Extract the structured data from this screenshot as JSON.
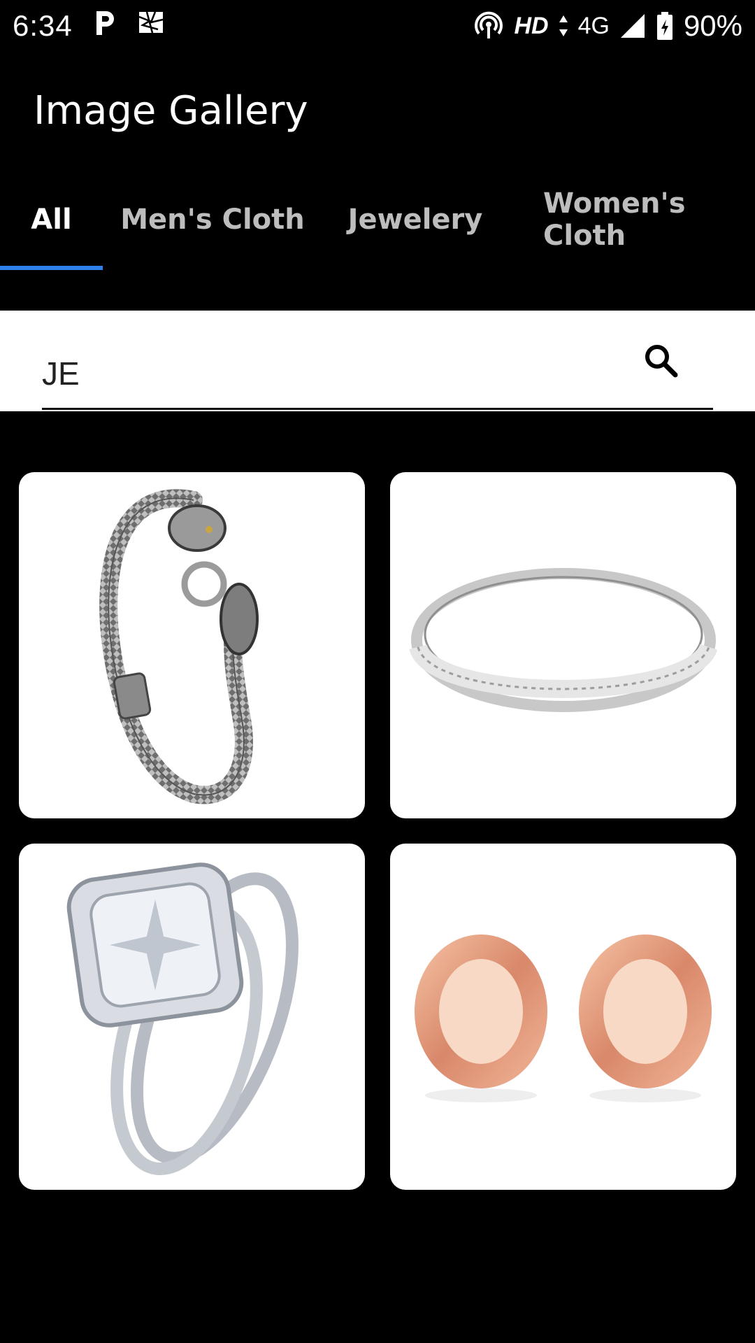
{
  "status_bar": {
    "time": "6:34",
    "network_hd": "HD",
    "network_type": "4G",
    "battery_percent": "90%",
    "icons": [
      "p-app-icon",
      "notification-icon",
      "hotspot-icon",
      "signal-icon",
      "battery-icon"
    ]
  },
  "app_bar": {
    "title": "Image Gallery"
  },
  "tabs": [
    {
      "label": "All",
      "selected": true
    },
    {
      "label": "Men's Cloth",
      "selected": false
    },
    {
      "label": "Jewelery",
      "selected": false
    },
    {
      "label": "Women's Cloth",
      "selected": false
    }
  ],
  "search": {
    "value": "JE",
    "icon": "search-icon"
  },
  "gallery": {
    "items": [
      {
        "subject": "silver dragon bracelet"
      },
      {
        "subject": "silver diamond band ring"
      },
      {
        "subject": "cushion cut engagement ring set"
      },
      {
        "subject": "rose gold ear tunnels"
      }
    ]
  },
  "colors": {
    "background": "#000000",
    "tab_indicator": "#2f80ed",
    "card_background": "#ffffff"
  }
}
